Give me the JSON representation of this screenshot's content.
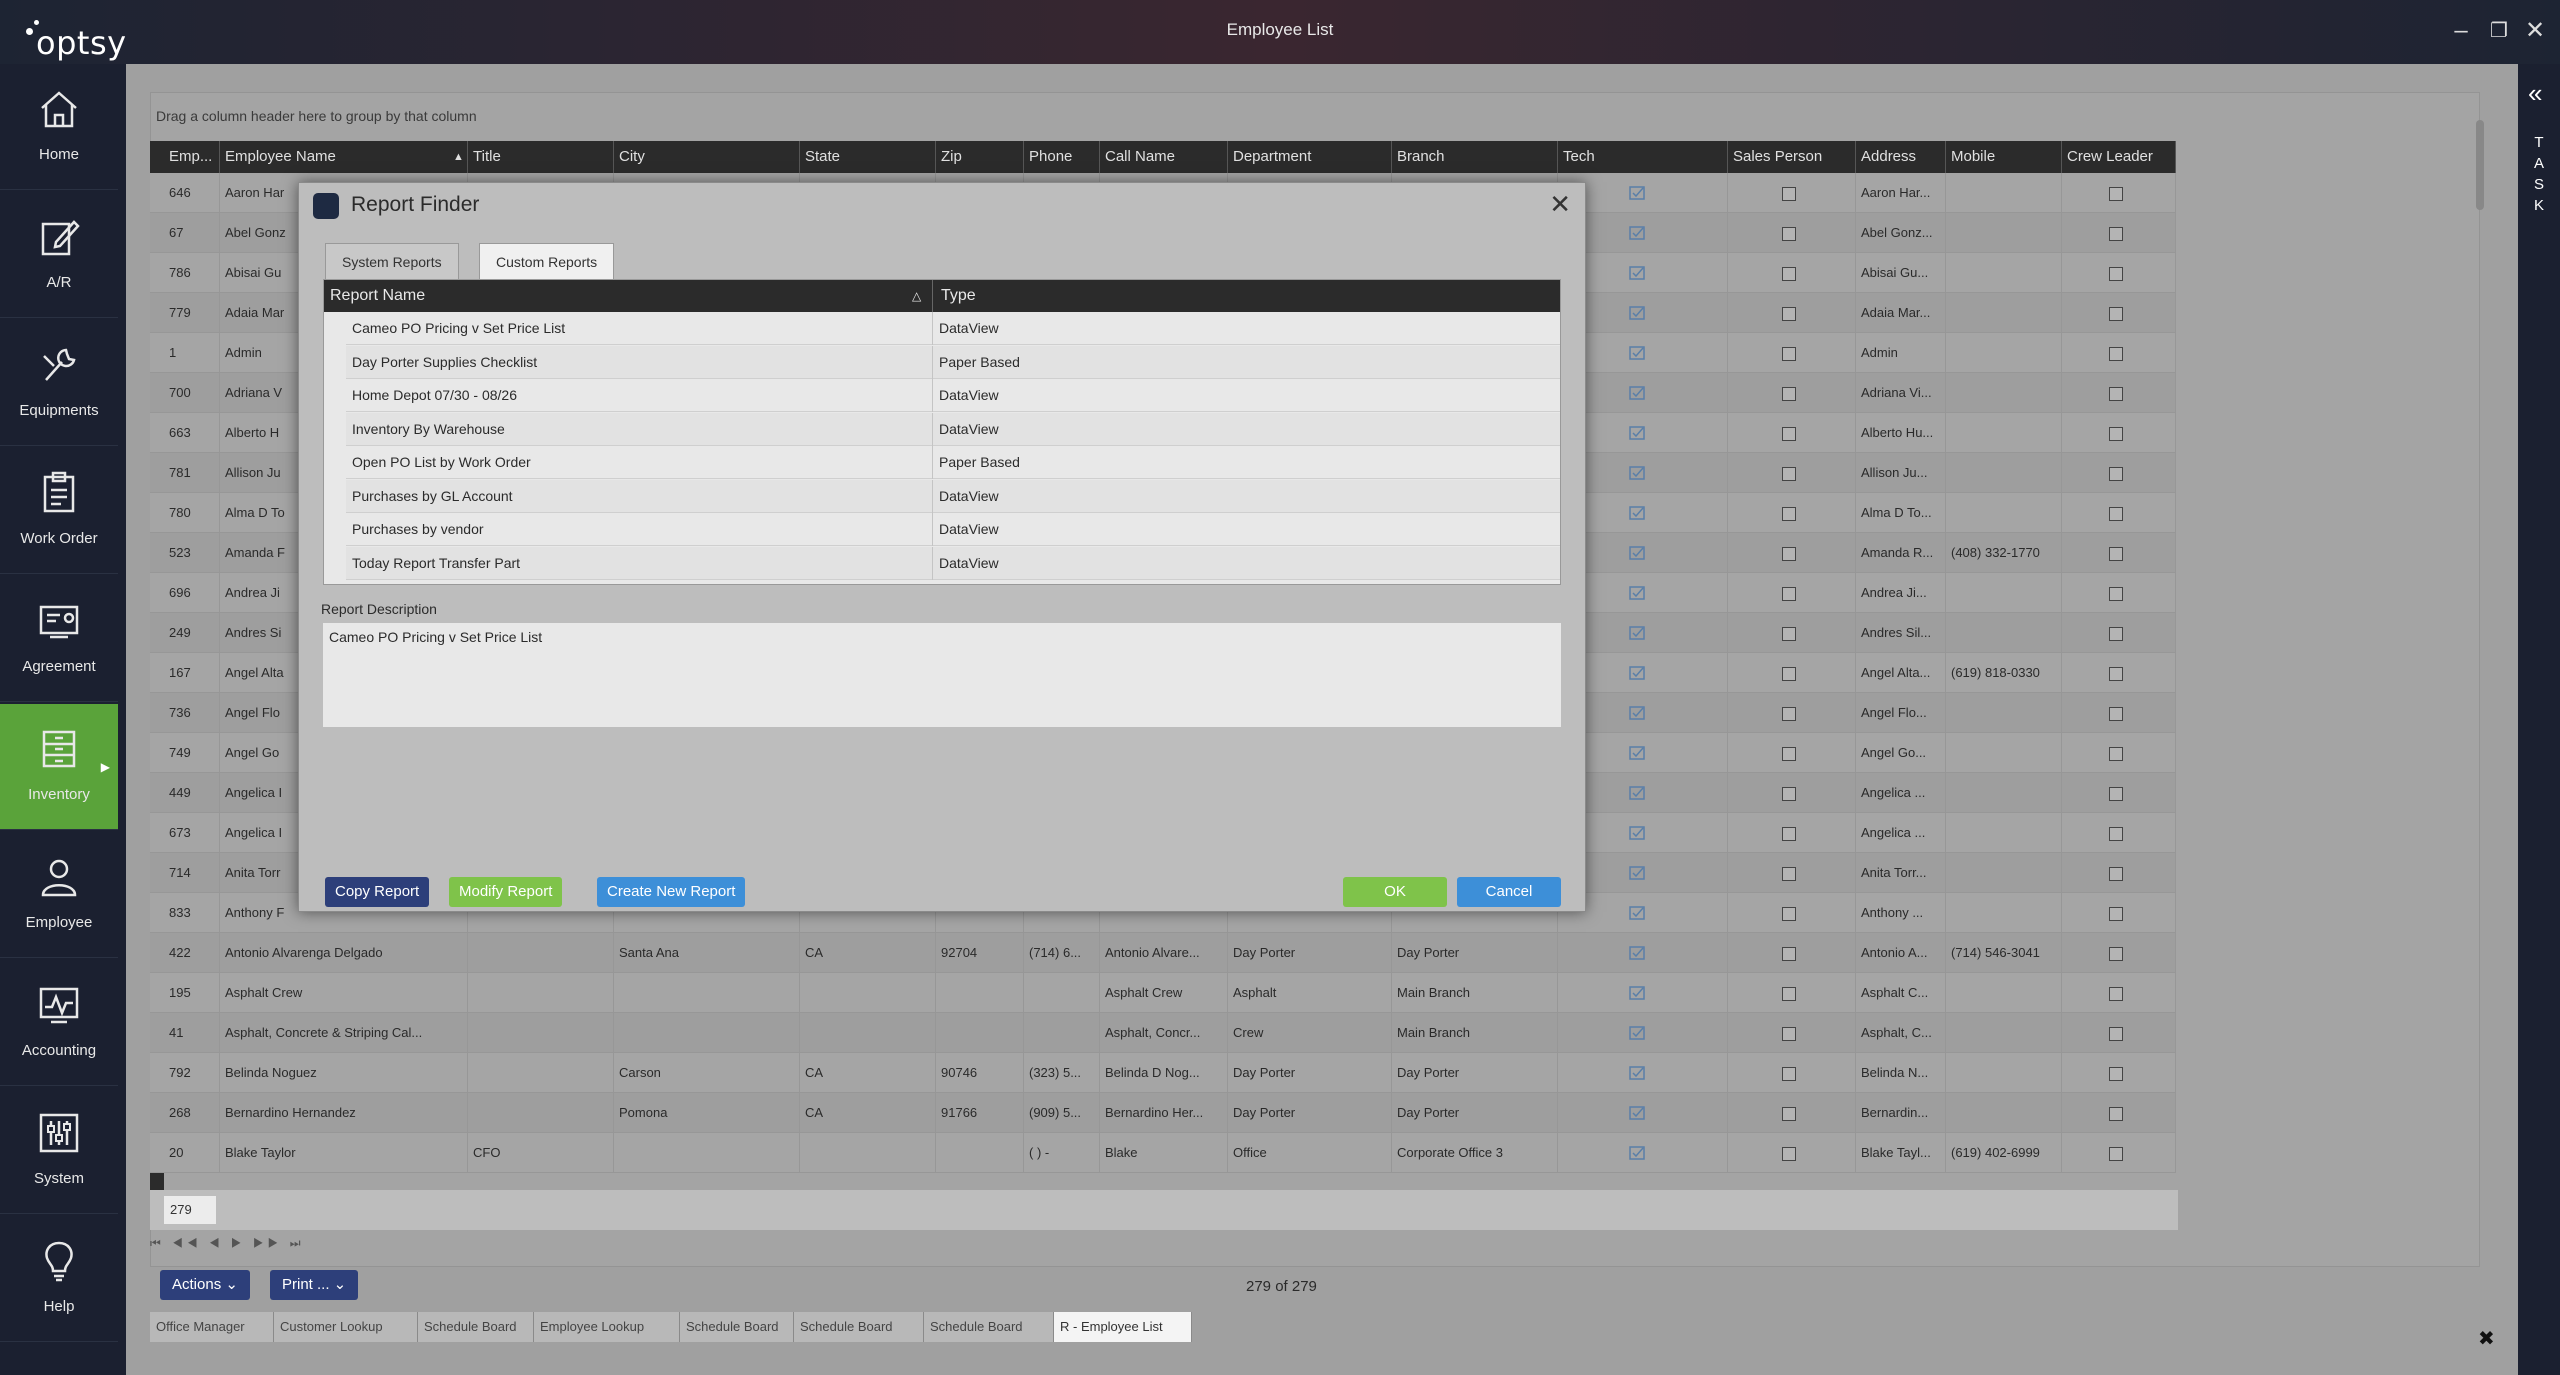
{
  "app": {
    "logo": "optsy",
    "window_title": "Employee List"
  },
  "window_controls": {
    "minimize": "–",
    "restore": "❐",
    "close": "✕"
  },
  "sidebar": {
    "items": [
      {
        "label": "Home",
        "icon": "home-icon"
      },
      {
        "label": "A/R",
        "icon": "edit-icon"
      },
      {
        "label": "Equipments",
        "icon": "tools-icon"
      },
      {
        "label": "Work Order",
        "icon": "clipboard-icon"
      },
      {
        "label": "Agreement",
        "icon": "agreement-icon"
      },
      {
        "label": "Inventory",
        "icon": "inventory-icon",
        "active": true
      },
      {
        "label": "Employee",
        "icon": "person-icon"
      },
      {
        "label": "Accounting",
        "icon": "chart-icon"
      },
      {
        "label": "System",
        "icon": "sliders-icon"
      },
      {
        "label": "Help",
        "icon": "lightbulb-icon"
      }
    ]
  },
  "task_rail": {
    "toggle": "«",
    "letters": [
      "T",
      "A",
      "S",
      "K"
    ]
  },
  "grid": {
    "group_hint": "Drag a column header here to group by that column",
    "columns": [
      "Emp...",
      "Employee Name",
      "Title",
      "City",
      "State",
      "Zip",
      "Phone",
      "Call Name",
      "Department",
      "Branch",
      "Tech",
      "Sales Person",
      "Address",
      "Mobile",
      "Crew Leader"
    ],
    "sort_indicator": "▲",
    "rows": [
      {
        "emp": "646",
        "name": "Aaron Har",
        "title": "",
        "city": "",
        "state": "",
        "zip": "",
        "phone": "",
        "call": "",
        "dept": "",
        "branch": "",
        "address": "Aaron Har...",
        "mobile": ""
      },
      {
        "emp": "67",
        "name": "Abel Gonz",
        "title": "",
        "city": "",
        "state": "",
        "zip": "",
        "phone": "",
        "call": "",
        "dept": "",
        "branch": "",
        "address": "Abel Gonz...",
        "mobile": ""
      },
      {
        "emp": "786",
        "name": "Abisai Gu",
        "title": "",
        "city": "",
        "state": "",
        "zip": "",
        "phone": "",
        "call": "",
        "dept": "",
        "branch": "",
        "address": "Abisai Gu...",
        "mobile": ""
      },
      {
        "emp": "779",
        "name": "Adaia Mar",
        "title": "",
        "city": "",
        "state": "",
        "zip": "",
        "phone": "",
        "call": "",
        "dept": "",
        "branch": "",
        "address": "Adaia Mar...",
        "mobile": ""
      },
      {
        "emp": "1",
        "name": "Admin",
        "title": "",
        "city": "",
        "state": "",
        "zip": "",
        "phone": "",
        "call": "",
        "dept": "",
        "branch": "",
        "address": "Admin",
        "mobile": ""
      },
      {
        "emp": "700",
        "name": "Adriana V",
        "title": "",
        "city": "",
        "state": "",
        "zip": "",
        "phone": "",
        "call": "",
        "dept": "",
        "branch": "",
        "address": "Adriana Vi...",
        "mobile": ""
      },
      {
        "emp": "663",
        "name": "Alberto H",
        "title": "",
        "city": "",
        "state": "",
        "zip": "",
        "phone": "",
        "call": "",
        "dept": "",
        "branch": "",
        "address": "Alberto Hu...",
        "mobile": ""
      },
      {
        "emp": "781",
        "name": "Allison Ju",
        "title": "",
        "city": "",
        "state": "",
        "zip": "",
        "phone": "",
        "call": "",
        "dept": "",
        "branch": "",
        "address": "Allison Ju...",
        "mobile": ""
      },
      {
        "emp": "780",
        "name": "Alma D To",
        "title": "",
        "city": "",
        "state": "",
        "zip": "",
        "phone": "",
        "call": "",
        "dept": "",
        "branch": "",
        "address": "Alma D To...",
        "mobile": ""
      },
      {
        "emp": "523",
        "name": "Amanda F",
        "title": "",
        "city": "",
        "state": "",
        "zip": "",
        "phone": "",
        "call": "",
        "dept": "",
        "branch": "",
        "address": "Amanda R...",
        "mobile": "(408) 332-1770"
      },
      {
        "emp": "696",
        "name": "Andrea Ji",
        "title": "",
        "city": "",
        "state": "",
        "zip": "",
        "phone": "",
        "call": "",
        "dept": "",
        "branch": "",
        "address": "Andrea Ji...",
        "mobile": ""
      },
      {
        "emp": "249",
        "name": "Andres Si",
        "title": "",
        "city": "",
        "state": "",
        "zip": "",
        "phone": "",
        "call": "",
        "dept": "",
        "branch": "",
        "address": "Andres Sil...",
        "mobile": ""
      },
      {
        "emp": "167",
        "name": "Angel Alta",
        "title": "",
        "city": "",
        "state": "",
        "zip": "",
        "phone": "",
        "call": "",
        "dept": "",
        "branch": "",
        "address": "Angel Alta...",
        "mobile": "(619) 818-0330"
      },
      {
        "emp": "736",
        "name": "Angel Flo",
        "title": "",
        "city": "",
        "state": "",
        "zip": "",
        "phone": "",
        "call": "",
        "dept": "",
        "branch": "",
        "address": "Angel Flo...",
        "mobile": ""
      },
      {
        "emp": "749",
        "name": "Angel Go",
        "title": "",
        "city": "",
        "state": "",
        "zip": "",
        "phone": "",
        "call": "",
        "dept": "",
        "branch": "",
        "address": "Angel Go...",
        "mobile": ""
      },
      {
        "emp": "449",
        "name": "Angelica I",
        "title": "",
        "city": "",
        "state": "",
        "zip": "",
        "phone": "",
        "call": "",
        "dept": "",
        "branch": "",
        "address": "Angelica ...",
        "mobile": ""
      },
      {
        "emp": "673",
        "name": "Angelica I",
        "title": "",
        "city": "",
        "state": "",
        "zip": "",
        "phone": "",
        "call": "",
        "dept": "",
        "branch": "",
        "address": "Angelica ...",
        "mobile": ""
      },
      {
        "emp": "714",
        "name": "Anita Torr",
        "title": "",
        "city": "",
        "state": "",
        "zip": "",
        "phone": "",
        "call": "",
        "dept": "",
        "branch": "",
        "address": "Anita Torr...",
        "mobile": ""
      },
      {
        "emp": "833",
        "name": "Anthony F",
        "title": "",
        "city": "",
        "state": "",
        "zip": "",
        "phone": "",
        "call": "",
        "dept": "",
        "branch": "",
        "address": "Anthony ...",
        "mobile": ""
      },
      {
        "emp": "422",
        "name": "Antonio Alvarenga Delgado",
        "title": "",
        "city": "Santa Ana",
        "state": "CA",
        "zip": "92704",
        "phone": "(714) 6...",
        "call": "Antonio Alvare...",
        "dept": "Day Porter",
        "branch": "Day Porter",
        "address": "Antonio A...",
        "mobile": "(714) 546-3041"
      },
      {
        "emp": "195",
        "name": "Asphalt Crew",
        "title": "",
        "city": "",
        "state": "",
        "zip": "",
        "phone": "",
        "call": "Asphalt Crew",
        "dept": "Asphalt",
        "branch": "Main Branch",
        "address": "Asphalt C...",
        "mobile": ""
      },
      {
        "emp": "41",
        "name": "Asphalt, Concrete & Striping Cal...",
        "title": "",
        "city": "",
        "state": "",
        "zip": "",
        "phone": "",
        "call": "Asphalt, Concr...",
        "dept": "Crew",
        "branch": "Main Branch",
        "address": "Asphalt, C...",
        "mobile": ""
      },
      {
        "emp": "792",
        "name": "Belinda Noguez",
        "title": "",
        "city": "Carson",
        "state": "CA",
        "zip": "90746",
        "phone": "(323) 5...",
        "call": "Belinda D Nog...",
        "dept": "Day Porter",
        "branch": "Day Porter",
        "address": "Belinda N...",
        "mobile": ""
      },
      {
        "emp": "268",
        "name": "Bernardino Hernandez",
        "title": "",
        "city": "Pomona",
        "state": "CA",
        "zip": "91766",
        "phone": "(909) 5...",
        "call": "Bernardino Her...",
        "dept": "Day Porter",
        "branch": "Day Porter",
        "address": "Bernardin...",
        "mobile": ""
      },
      {
        "emp": "20",
        "name": "Blake Taylor",
        "title": "CFO",
        "city": "",
        "state": "",
        "zip": "",
        "phone": "(  )  -",
        "call": "Blake",
        "dept": "Office",
        "branch": "Corporate Office 3",
        "address": "Blake Tayl...",
        "mobile": "(619) 402-6999"
      }
    ],
    "count": "279",
    "pager": "⏮ ◀◀ ◀ ▶ ▶▶ ⏭"
  },
  "footer": {
    "actions_label": "Actions ⌄",
    "print_label": "Print ... ⌄",
    "record_count": "279 of 279",
    "tabs": [
      "Office Manager",
      "Customer Lookup",
      "Schedule Board",
      "Employee Lookup",
      "Schedule Board",
      "Schedule Board",
      "Schedule Board",
      "R - Employee List"
    ],
    "active_tab": 7,
    "close": "✖"
  },
  "modal": {
    "title": "Report Finder",
    "close": "✕",
    "tabs": [
      "System Reports",
      "Custom Reports"
    ],
    "active_tab": 1,
    "columns": {
      "name": "Report Name",
      "type": "Type",
      "sort": "△"
    },
    "reports": [
      {
        "name": "Cameo PO Pricing v Set Price List",
        "type": "DataView"
      },
      {
        "name": "Day Porter Supplies Checklist",
        "type": "Paper Based"
      },
      {
        "name": "Home Depot 07/30 - 08/26",
        "type": "DataView"
      },
      {
        "name": "Inventory By Warehouse",
        "type": "DataView"
      },
      {
        "name": "Open PO List by Work Order",
        "type": "Paper Based"
      },
      {
        "name": "Purchases by GL Account",
        "type": "DataView"
      },
      {
        "name": "Purchases by vendor",
        "type": "DataView"
      },
      {
        "name": "Today Report Transfer Part",
        "type": "DataView"
      }
    ],
    "description_label": "Report Description",
    "description": "Cameo PO Pricing v Set Price List",
    "buttons": {
      "copy": "Copy Report",
      "modify": "Modify Report",
      "create": "Create New Report",
      "ok": "OK",
      "cancel": "Cancel"
    }
  },
  "colors": {
    "sidebar_bg": "#1b2030",
    "active_nav": "#5aa33a",
    "copy_btn": "#2d3f7a",
    "modify_btn": "#7fc34a",
    "create_btn": "#3d8fd8",
    "ok_btn": "#7fc34a",
    "cancel_btn": "#3d8fd8"
  }
}
